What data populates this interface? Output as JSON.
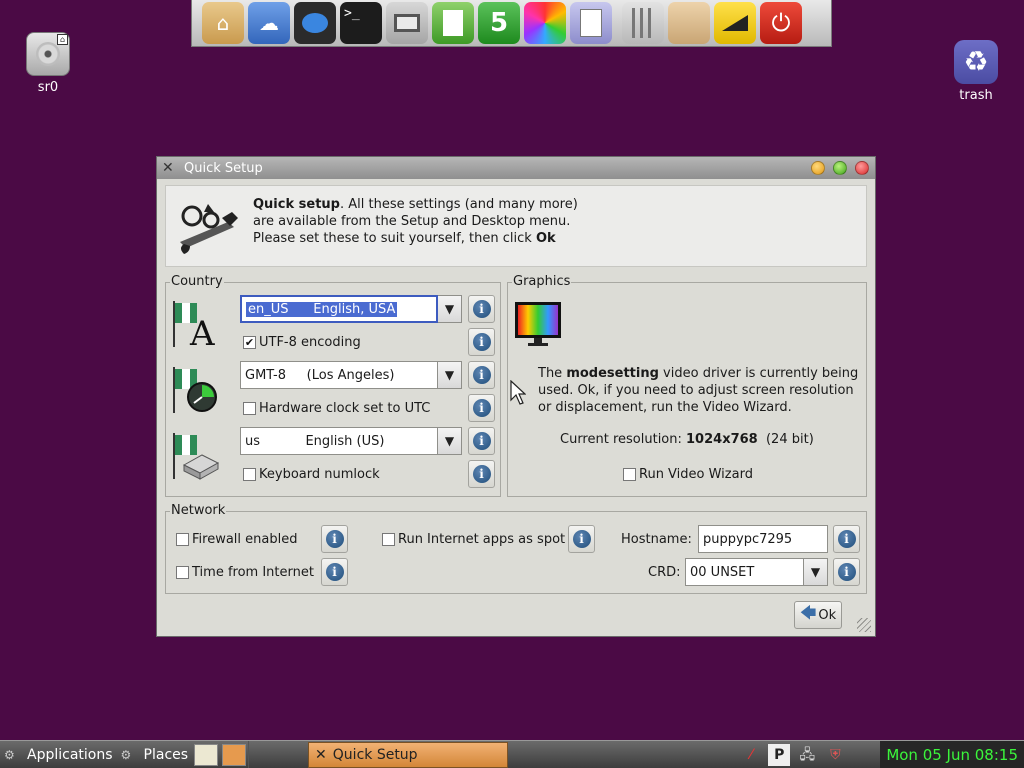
{
  "desktop": {
    "icons": [
      {
        "label": "sr0"
      },
      {
        "label": "trash"
      }
    ]
  },
  "dock": {
    "items": [
      "home-folder-icon",
      "cloud-icon",
      "chat-icon",
      "terminal-icon",
      "monitor-icon",
      "document-icon",
      "spreadsheet-icon",
      "color-wheel-icon",
      "text-editor-icon",
      "mixer-icon",
      "folder-icon",
      "volume-icon",
      "power-icon"
    ],
    "terminal_glyph": ">_",
    "spreadsheet_glyph": "5"
  },
  "window": {
    "title": "Quick Setup",
    "intro": {
      "bold1": "Quick setup",
      "text1": ". All these settings (and many more)",
      "line2": "are available from the Setup and Desktop menu.",
      "line3_pre": "Please set these to suit yourself, then click ",
      "line3_bold": "Ok"
    },
    "country": {
      "legend": "Country",
      "locale_value": "en_US      English, USA",
      "utf8_label": "UTF-8 encoding",
      "utf8_checked": true,
      "timezone_value": "GMT-8     (Los Angeles)",
      "hwclock_label": "Hardware clock set to UTC",
      "hwclock_checked": false,
      "keyboard_value": "us           English (US)",
      "numlock_label": "Keyboard numlock",
      "numlock_checked": false
    },
    "graphics": {
      "legend": "Graphics",
      "desc_pre": "The ",
      "desc_bold": "modesetting",
      "desc_post": " video driver is currently being",
      "desc_line2": "used. Ok, if you need to adjust screen resolution",
      "desc_line3": "or displacement, run the Video Wizard.",
      "res_label": "Current resolution: ",
      "res_value": "1024x768",
      "res_depth": "  (24 bit)",
      "wizard_label": "Run Video Wizard",
      "wizard_checked": false
    },
    "network": {
      "legend": "Network",
      "firewall_label": "Firewall enabled",
      "firewall_checked": false,
      "spot_label": "Run Internet apps as spot",
      "spot_checked": false,
      "hostname_label": "Hostname:",
      "hostname_value": "puppypc7295",
      "timeinet_label": "Time from Internet",
      "timeinet_checked": false,
      "crd_label": "CRD:",
      "crd_value": "00 UNSET"
    },
    "ok_label": "Ok",
    "info_glyph": "i"
  },
  "taskbar": {
    "applications_label": "Applications",
    "places_label": "Places",
    "task_label": "Quick Setup",
    "clock": "Mon 05 Jun 08:15"
  },
  "colors": {
    "desktop": "#4b0a45",
    "selection": "#4a6bd1",
    "task_active": "#e69a4e",
    "clock": "#3bf53b"
  }
}
